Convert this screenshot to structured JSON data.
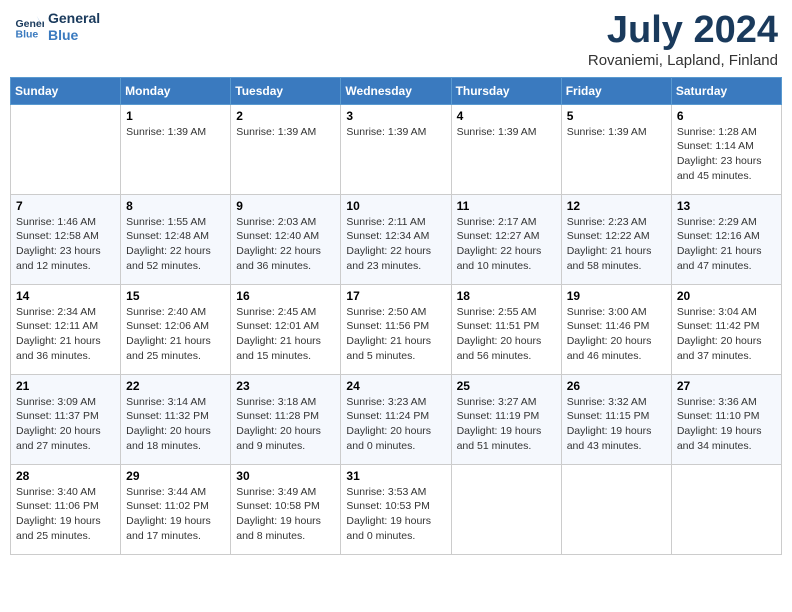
{
  "header": {
    "logo_line1": "General",
    "logo_line2": "Blue",
    "month": "July 2024",
    "location": "Rovaniemi, Lapland, Finland"
  },
  "weekdays": [
    "Sunday",
    "Monday",
    "Tuesday",
    "Wednesday",
    "Thursday",
    "Friday",
    "Saturday"
  ],
  "weeks": [
    [
      {
        "day": "",
        "info": ""
      },
      {
        "day": "1",
        "info": "Sunrise: 1:39 AM"
      },
      {
        "day": "2",
        "info": "Sunrise: 1:39 AM"
      },
      {
        "day": "3",
        "info": "Sunrise: 1:39 AM"
      },
      {
        "day": "4",
        "info": "Sunrise: 1:39 AM"
      },
      {
        "day": "5",
        "info": "Sunrise: 1:39 AM"
      },
      {
        "day": "6",
        "info": "Sunrise: 1:28 AM\nSunset: 1:14 AM\nDaylight: 23 hours and 45 minutes."
      }
    ],
    [
      {
        "day": "7",
        "info": "Sunrise: 1:46 AM\nSunset: 12:58 AM\nDaylight: 23 hours and 12 minutes."
      },
      {
        "day": "8",
        "info": "Sunrise: 1:55 AM\nSunset: 12:48 AM\nDaylight: 22 hours and 52 minutes."
      },
      {
        "day": "9",
        "info": "Sunrise: 2:03 AM\nSunset: 12:40 AM\nDaylight: 22 hours and 36 minutes."
      },
      {
        "day": "10",
        "info": "Sunrise: 2:11 AM\nSunset: 12:34 AM\nDaylight: 22 hours and 23 minutes."
      },
      {
        "day": "11",
        "info": "Sunrise: 2:17 AM\nSunset: 12:27 AM\nDaylight: 22 hours and 10 minutes."
      },
      {
        "day": "12",
        "info": "Sunrise: 2:23 AM\nSunset: 12:22 AM\nDaylight: 21 hours and 58 minutes."
      },
      {
        "day": "13",
        "info": "Sunrise: 2:29 AM\nSunset: 12:16 AM\nDaylight: 21 hours and 47 minutes."
      }
    ],
    [
      {
        "day": "14",
        "info": "Sunrise: 2:34 AM\nSunset: 12:11 AM\nDaylight: 21 hours and 36 minutes."
      },
      {
        "day": "15",
        "info": "Sunrise: 2:40 AM\nSunset: 12:06 AM\nDaylight: 21 hours and 25 minutes."
      },
      {
        "day": "16",
        "info": "Sunrise: 2:45 AM\nSunset: 12:01 AM\nDaylight: 21 hours and 15 minutes."
      },
      {
        "day": "17",
        "info": "Sunrise: 2:50 AM\nSunset: 11:56 PM\nDaylight: 21 hours and 5 minutes."
      },
      {
        "day": "18",
        "info": "Sunrise: 2:55 AM\nSunset: 11:51 PM\nDaylight: 20 hours and 56 minutes."
      },
      {
        "day": "19",
        "info": "Sunrise: 3:00 AM\nSunset: 11:46 PM\nDaylight: 20 hours and 46 minutes."
      },
      {
        "day": "20",
        "info": "Sunrise: 3:04 AM\nSunset: 11:42 PM\nDaylight: 20 hours and 37 minutes."
      }
    ],
    [
      {
        "day": "21",
        "info": "Sunrise: 3:09 AM\nSunset: 11:37 PM\nDaylight: 20 hours and 27 minutes."
      },
      {
        "day": "22",
        "info": "Sunrise: 3:14 AM\nSunset: 11:32 PM\nDaylight: 20 hours and 18 minutes."
      },
      {
        "day": "23",
        "info": "Sunrise: 3:18 AM\nSunset: 11:28 PM\nDaylight: 20 hours and 9 minutes."
      },
      {
        "day": "24",
        "info": "Sunrise: 3:23 AM\nSunset: 11:24 PM\nDaylight: 20 hours and 0 minutes."
      },
      {
        "day": "25",
        "info": "Sunrise: 3:27 AM\nSunset: 11:19 PM\nDaylight: 19 hours and 51 minutes."
      },
      {
        "day": "26",
        "info": "Sunrise: 3:32 AM\nSunset: 11:15 PM\nDaylight: 19 hours and 43 minutes."
      },
      {
        "day": "27",
        "info": "Sunrise: 3:36 AM\nSunset: 11:10 PM\nDaylight: 19 hours and 34 minutes."
      }
    ],
    [
      {
        "day": "28",
        "info": "Sunrise: 3:40 AM\nSunset: 11:06 PM\nDaylight: 19 hours and 25 minutes."
      },
      {
        "day": "29",
        "info": "Sunrise: 3:44 AM\nSunset: 11:02 PM\nDaylight: 19 hours and 17 minutes."
      },
      {
        "day": "30",
        "info": "Sunrise: 3:49 AM\nSunset: 10:58 PM\nDaylight: 19 hours and 8 minutes."
      },
      {
        "day": "31",
        "info": "Sunrise: 3:53 AM\nSunset: 10:53 PM\nDaylight: 19 hours and 0 minutes."
      },
      {
        "day": "",
        "info": ""
      },
      {
        "day": "",
        "info": ""
      },
      {
        "day": "",
        "info": ""
      }
    ]
  ]
}
